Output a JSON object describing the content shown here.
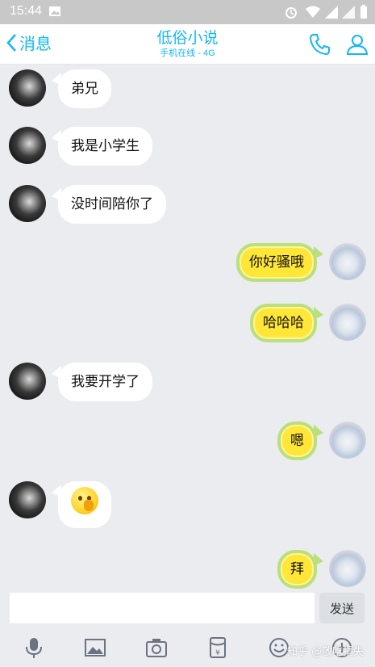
{
  "status_bar": {
    "time": "15:44",
    "icons": [
      "image-notification-icon",
      "alarm-icon",
      "wifi-icon",
      "signal-icon",
      "signal-icon",
      "battery-icon"
    ]
  },
  "header": {
    "back_label": "消息",
    "title": "低俗小说",
    "subtitle": "手机在线 - 4G",
    "actions": [
      "phone-icon",
      "profile-icon"
    ]
  },
  "accent_color": "#12b7f5",
  "messages": [
    {
      "side": "in",
      "text": "弟兄"
    },
    {
      "side": "in",
      "text": "我是小学生"
    },
    {
      "side": "in",
      "text": "没时间陪你了"
    },
    {
      "side": "out",
      "text": "你好骚哦"
    },
    {
      "side": "out",
      "text": "哈哈哈"
    },
    {
      "side": "in",
      "text": "我要开学了"
    },
    {
      "side": "out",
      "text": "嗯"
    },
    {
      "side": "in",
      "emoji": "thinking-emoji"
    },
    {
      "side": "out",
      "text": "拜"
    }
  ],
  "composer": {
    "value": "",
    "placeholder": "",
    "send_label": "发送"
  },
  "toolbar": [
    "microphone-icon",
    "picture-icon",
    "camera-icon",
    "red-packet-icon",
    "emoji-icon",
    "plus-icon"
  ],
  "watermark": "知乎 @敬吃捐失"
}
